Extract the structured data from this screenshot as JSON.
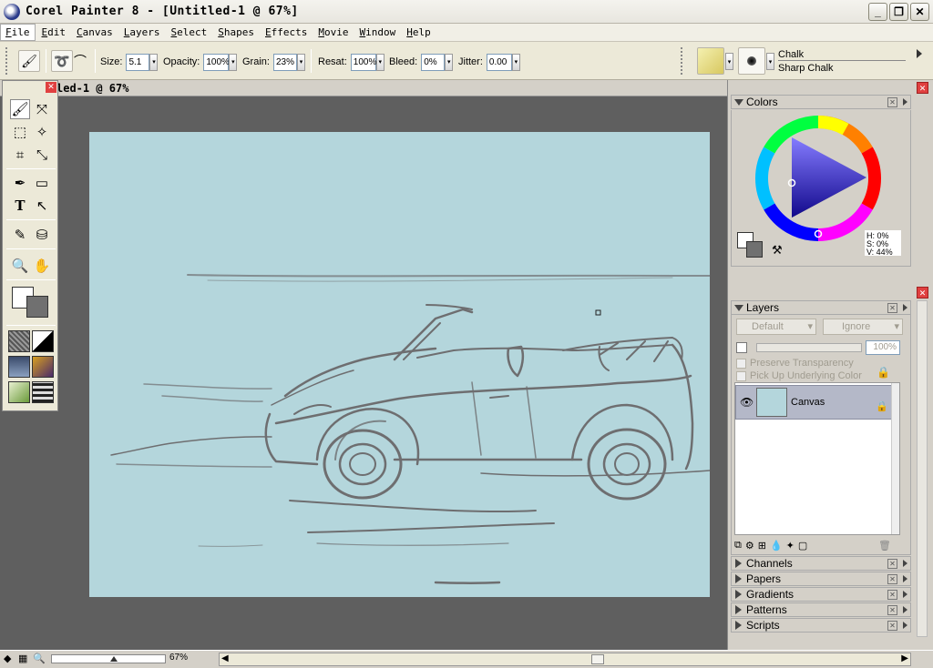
{
  "window": {
    "title": "Corel Painter 8 - [Untitled-1 @ 67%]"
  },
  "menu": [
    "File",
    "Edit",
    "Canvas",
    "Layers",
    "Select",
    "Shapes",
    "Effects",
    "Movie",
    "Window",
    "Help"
  ],
  "property_bar": {
    "size_label": "Size:",
    "size_value": "5.1",
    "opacity_label": "Opacity:",
    "opacity_value": "100%",
    "grain_label": "Grain:",
    "grain_value": "23%",
    "resat_label": "Resat:",
    "resat_value": "100%",
    "bleed_label": "Bleed:",
    "bleed_value": "0%",
    "jitter_label": "Jitter:",
    "jitter_value": "0.00",
    "brush_category": "Chalk",
    "brush_variant": "Sharp Chalk"
  },
  "document": {
    "title": "led-1 @ 67%",
    "canvas_color": "#b4d6dc"
  },
  "colors_panel": {
    "title": "Colors",
    "h": "H: 0%",
    "s": "S: 0%",
    "v": "V: 44%"
  },
  "layers_panel": {
    "title": "Layers",
    "composite_method": "Default",
    "composite_depth": "Ignore",
    "opacity_value": "100%",
    "preserve_transparency": "Preserve Transparency",
    "pick_up_underlying": "Pick Up Underlying Color",
    "layers": [
      {
        "name": "Canvas"
      }
    ]
  },
  "collapsed_panels": [
    "Channels",
    "Papers",
    "Gradients",
    "Patterns",
    "Scripts"
  ],
  "status": {
    "zoom": "67%"
  }
}
